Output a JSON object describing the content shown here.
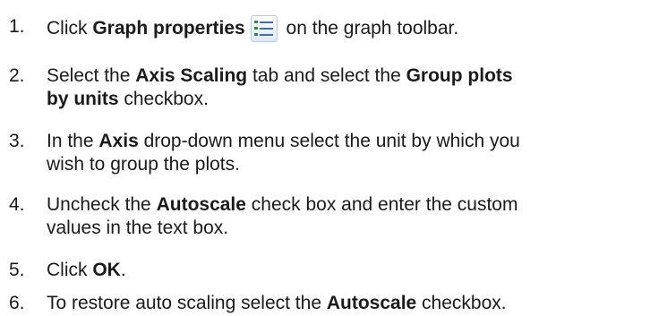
{
  "steps": [
    {
      "number": "1.",
      "parts": [
        "Click ",
        "Graph properties",
        " on the graph toolbar."
      ],
      "icon": "graph-properties-icon"
    },
    {
      "number": "2.",
      "parts": [
        "Select the ",
        "Axis Scaling",
        " tab and select the ",
        "Group plots",
        "by units",
        " checkbox."
      ]
    },
    {
      "number": "3.",
      "parts": [
        "In the ",
        "Axis",
        " drop-down menu select the unit by which you",
        "wish to group the plots."
      ]
    },
    {
      "number": "4.",
      "parts": [
        "Uncheck the ",
        "Autoscale",
        " check box and enter the custom",
        "values in the text box."
      ]
    },
    {
      "number": "5.",
      "parts": [
        "Click ",
        "OK",
        "."
      ]
    },
    {
      "number": "6.",
      "parts": [
        "To restore auto scaling select the ",
        "Autoscale",
        " checkbox."
      ]
    }
  ],
  "colors": {
    "text": "#1a1a1a",
    "icon_bullets": "#2f8f2f",
    "icon_lines": "#3a6fb0"
  }
}
